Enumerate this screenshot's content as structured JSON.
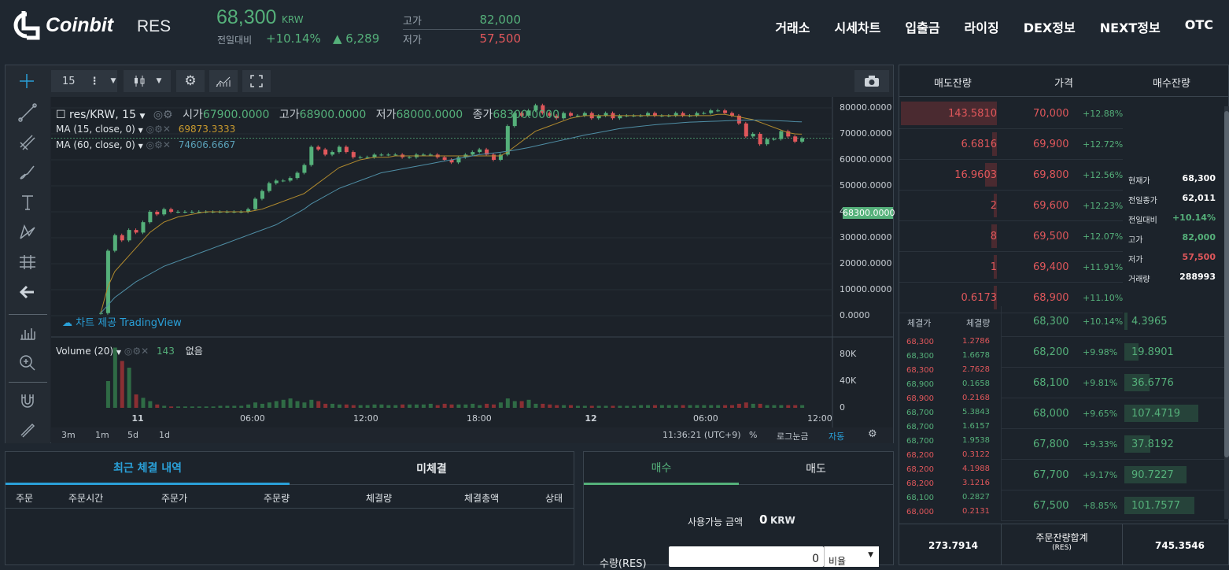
{
  "header": {
    "brand": "Coinbit",
    "symbol": "RES",
    "price": "68,300",
    "unit": "KRW",
    "change_label": "전일대비",
    "change_pct": "+10.14%",
    "change_abs": "▲ 6,289",
    "high_label": "고가",
    "high": "82,000",
    "low_label": "저가",
    "low": "57,500"
  },
  "nav": [
    "거래소",
    "시세차트",
    "입출금",
    "라이징",
    "DEX정보",
    "NEXT정보",
    "OTC"
  ],
  "chart": {
    "interval": "15",
    "legend_main": "res/KRW, 15",
    "ohlc": [
      [
        "시가",
        "67900.0000"
      ],
      [
        "고가",
        "68900.0000"
      ],
      [
        "저가",
        "68000.0000"
      ],
      [
        "종가",
        "68300.0000"
      ]
    ],
    "ma15_label": "MA (15, close, 0)",
    "ma15_value": "69873.3333",
    "ma60_label": "MA (60, close, 0)",
    "ma60_value": "74606.6667",
    "volume_label": "Volume (20)",
    "volume_value": "143",
    "volume_extra": "없음",
    "watermark": "차트 제공 TradingView",
    "price_tag": "68300.0000",
    "y_ticks": [
      "80000.0000",
      "70000.0000",
      "60000.0000",
      "50000.0000",
      "40000.0000",
      "30000.0000",
      "20000.0000",
      "10000.0000",
      "0.0000"
    ],
    "vol_ticks": [
      "80K",
      "40K",
      "0"
    ],
    "x_ticks": [
      "11",
      "06:00",
      "12:00",
      "18:00",
      "12",
      "06:00",
      "12:00"
    ],
    "ranges": [
      "3m",
      "1m",
      "5d",
      "1d"
    ],
    "clock": "11:36:21 (UTC+9)",
    "pct": "%",
    "log": "로그눈금",
    "auto": "자동"
  },
  "chart_data": {
    "type": "candlestick",
    "xlabel": "",
    "ylabel": "",
    "ylim": [
      0,
      80000
    ],
    "close": [
      1000,
      25000,
      31000,
      29000,
      33000,
      32000,
      36000,
      40000,
      39000,
      41000,
      40000,
      40000,
      40000,
      40000,
      40000,
      40000,
      40000,
      40000,
      40000,
      40000,
      40000,
      41000,
      45000,
      48000,
      51000,
      52000,
      52000,
      53000,
      55000,
      58000,
      65000,
      64000,
      62000,
      63000,
      65000,
      63000,
      61000,
      61000,
      61000,
      62000,
      62000,
      62000,
      62000,
      61000,
      61000,
      62000,
      62000,
      62000,
      61000,
      60000,
      59000,
      61000,
      62000,
      63000,
      64000,
      62000,
      60000,
      62000,
      73000,
      78000,
      77000,
      79000,
      81000,
      78000,
      77000,
      76000,
      78000,
      77000,
      77000,
      78000,
      76000,
      77000,
      78000,
      76000,
      77000,
      77000,
      77000,
      77000,
      78000,
      77000,
      77000,
      77000,
      78000,
      77000,
      77000,
      78000,
      78000,
      79000,
      79000,
      78000,
      77000,
      74000,
      69000,
      70000,
      66000,
      68000,
      68000,
      71000,
      69000,
      67000,
      68300
    ],
    "volume_k": [
      0,
      40,
      90,
      70,
      60,
      20,
      15,
      10,
      5,
      3,
      2,
      2,
      2,
      2,
      2,
      2,
      2,
      3,
      3,
      3,
      3,
      5,
      8,
      6,
      8,
      10,
      12,
      14,
      10,
      8,
      12,
      10,
      6,
      6,
      5,
      5,
      4,
      4,
      4,
      5,
      5,
      4,
      4,
      5,
      5,
      5,
      5,
      6,
      4,
      6,
      5,
      5,
      5,
      6,
      4,
      6,
      5,
      8,
      14,
      10,
      10,
      12,
      6,
      6,
      5,
      4,
      4,
      4,
      3,
      3,
      3,
      3,
      3,
      3,
      3,
      3,
      3,
      4,
      4,
      4,
      4,
      4,
      4,
      4,
      4,
      4,
      4,
      4,
      4,
      4,
      4,
      6,
      8,
      6,
      6,
      4,
      4,
      4,
      4,
      4,
      4
    ],
    "ma15": [
      1000,
      11000,
      17000,
      20000,
      23000,
      26000,
      29000,
      32000,
      34000,
      36000,
      37000,
      38000,
      38500,
      39000,
      39500,
      40000,
      40000,
      40000,
      40000,
      40000,
      40000,
      40000,
      40500,
      41000,
      42000,
      43000,
      44000,
      45000,
      46000,
      47000,
      49000,
      51000,
      53000,
      55000,
      57000,
      58000,
      59000,
      60000,
      60500,
      61000,
      61000,
      61000,
      61500,
      61500,
      61500,
      61500,
      61500,
      61500,
      61500,
      61500,
      61500,
      61500,
      61500,
      61500,
      61500,
      61500,
      61500,
      61500,
      63000,
      65000,
      67000,
      69000,
      71000,
      72000,
      73000,
      74000,
      75000,
      76000,
      76500,
      77000,
      77000,
      77000,
      77000,
      77000,
      77000,
      77000,
      77000,
      77000,
      77000,
      77000,
      77000,
      77000,
      77000,
      77000,
      77000,
      77000,
      77000,
      77000,
      77500,
      77500,
      77000,
      76500,
      76000,
      75500,
      74500,
      73500,
      72500,
      71500,
      70500,
      70000,
      69873
    ],
    "ma60": [
      1000,
      4000,
      7000,
      9000,
      11000,
      13000,
      14500,
      16000,
      17500,
      19000,
      20000,
      21000,
      22000,
      23000,
      24000,
      25000,
      26000,
      27000,
      28000,
      29000,
      30000,
      31000,
      32000,
      33000,
      34000,
      35000,
      36500,
      38000,
      39500,
      41000,
      43000,
      44500,
      46000,
      47500,
      49000,
      50000,
      51000,
      52000,
      53000,
      54000,
      55000,
      55500,
      56000,
      56500,
      57000,
      57500,
      58000,
      58500,
      59000,
      59500,
      60000,
      60500,
      61000,
      61500,
      62000,
      62300,
      62600,
      62900,
      63300,
      63700,
      64200,
      64700,
      65300,
      65900,
      66500,
      67100,
      67700,
      68300,
      68900,
      69500,
      70000,
      70500,
      71000,
      71500,
      72000,
      72300,
      72600,
      72900,
      73200,
      73500,
      73700,
      73900,
      74100,
      74300,
      74500,
      74600,
      74700,
      74800,
      74900,
      75000,
      75100,
      75200,
      75300,
      75300,
      75300,
      75200,
      75100,
      75000,
      74900,
      74700,
      74606
    ]
  },
  "book": {
    "ask_header": "매도잔량",
    "price_header": "가격",
    "bid_header": "매수잔량",
    "asks": [
      {
        "qty": "143.5810",
        "price": "70,000",
        "pct": "+12.88%",
        "bar": 1.0
      },
      {
        "qty": "6.6816",
        "price": "69,900",
        "pct": "+12.72%",
        "bar": 0.05
      },
      {
        "qty": "16.9603",
        "price": "69,800",
        "pct": "+12.56%",
        "bar": 0.12
      },
      {
        "qty": "2",
        "price": "69,600",
        "pct": "+12.23%",
        "bar": 0.03
      },
      {
        "qty": "8",
        "price": "69,500",
        "pct": "+12.07%",
        "bar": 0.06
      },
      {
        "qty": "1",
        "price": "69,400",
        "pct": "+11.91%",
        "bar": 0.02
      },
      {
        "qty": "0.6173",
        "price": "68,900",
        "pct": "+11.10%",
        "bar": 0.01
      }
    ],
    "bids": [
      {
        "qty": "4.3965",
        "price": "68,300",
        "pct": "+10.14%",
        "bar": 0.04
      },
      {
        "qty": "19.8901",
        "price": "68,200",
        "pct": "+9.98%",
        "bar": 0.19
      },
      {
        "qty": "36.6776",
        "price": "68,100",
        "pct": "+9.81%",
        "bar": 0.34
      },
      {
        "qty": "107.4719",
        "price": "68,000",
        "pct": "+9.65%",
        "bar": 1.0
      },
      {
        "qty": "37.8192",
        "price": "67,800",
        "pct": "+9.33%",
        "bar": 0.35
      },
      {
        "qty": "90.7227",
        "price": "67,700",
        "pct": "+9.17%",
        "bar": 0.84
      },
      {
        "qty": "101.7577",
        "price": "67,500",
        "pct": "+8.85%",
        "bar": 0.95
      }
    ],
    "info": [
      [
        "현재가",
        "68,300"
      ],
      [
        "전일종가",
        "62,011"
      ],
      [
        "전일대비",
        "+10.14%"
      ],
      [
        "고가",
        "82,000"
      ],
      [
        "저가",
        "57,500"
      ],
      [
        "거래량",
        "288993"
      ]
    ],
    "trades_header": [
      "체결가",
      "체결량"
    ],
    "trades": [
      [
        "68,300",
        "1.2786",
        "red"
      ],
      [
        "68,300",
        "1.6678",
        "green"
      ],
      [
        "68,300",
        "2.7628",
        "red"
      ],
      [
        "68,900",
        "0.1658",
        "green"
      ],
      [
        "68,900",
        "0.2168",
        "red"
      ],
      [
        "68,700",
        "5.3843",
        "green"
      ],
      [
        "68,700",
        "1.6157",
        "green"
      ],
      [
        "68,700",
        "1.9538",
        "green"
      ],
      [
        "68,200",
        "0.3122",
        "red"
      ],
      [
        "68,200",
        "4.1988",
        "red"
      ],
      [
        "68,200",
        "3.1216",
        "red"
      ],
      [
        "68,100",
        "0.2827",
        "green"
      ],
      [
        "68,000",
        "0.2131",
        "red"
      ]
    ],
    "total_ask": "273.7914",
    "total_label": "주문잔량합계",
    "total_unit": "(RES)",
    "total_bid": "745.3546"
  },
  "orders": {
    "tab_active": "최근 체결 내역",
    "tab_other": "미체결",
    "columns": [
      "주문",
      "주문시간",
      "주문가",
      "주문량",
      "체결량",
      "체결총액",
      "상태"
    ]
  },
  "form": {
    "tab_buy": "매수",
    "tab_sell": "매도",
    "avail_label": "사용가능 금액",
    "avail_value": "0",
    "avail_unit": "KRW",
    "qty_label": "수량(RES)",
    "qty_value": "0",
    "ratio": "비율"
  },
  "colors": {
    "up": "#55b07a",
    "down": "#e0575b",
    "accent": "#2aa0d8"
  }
}
